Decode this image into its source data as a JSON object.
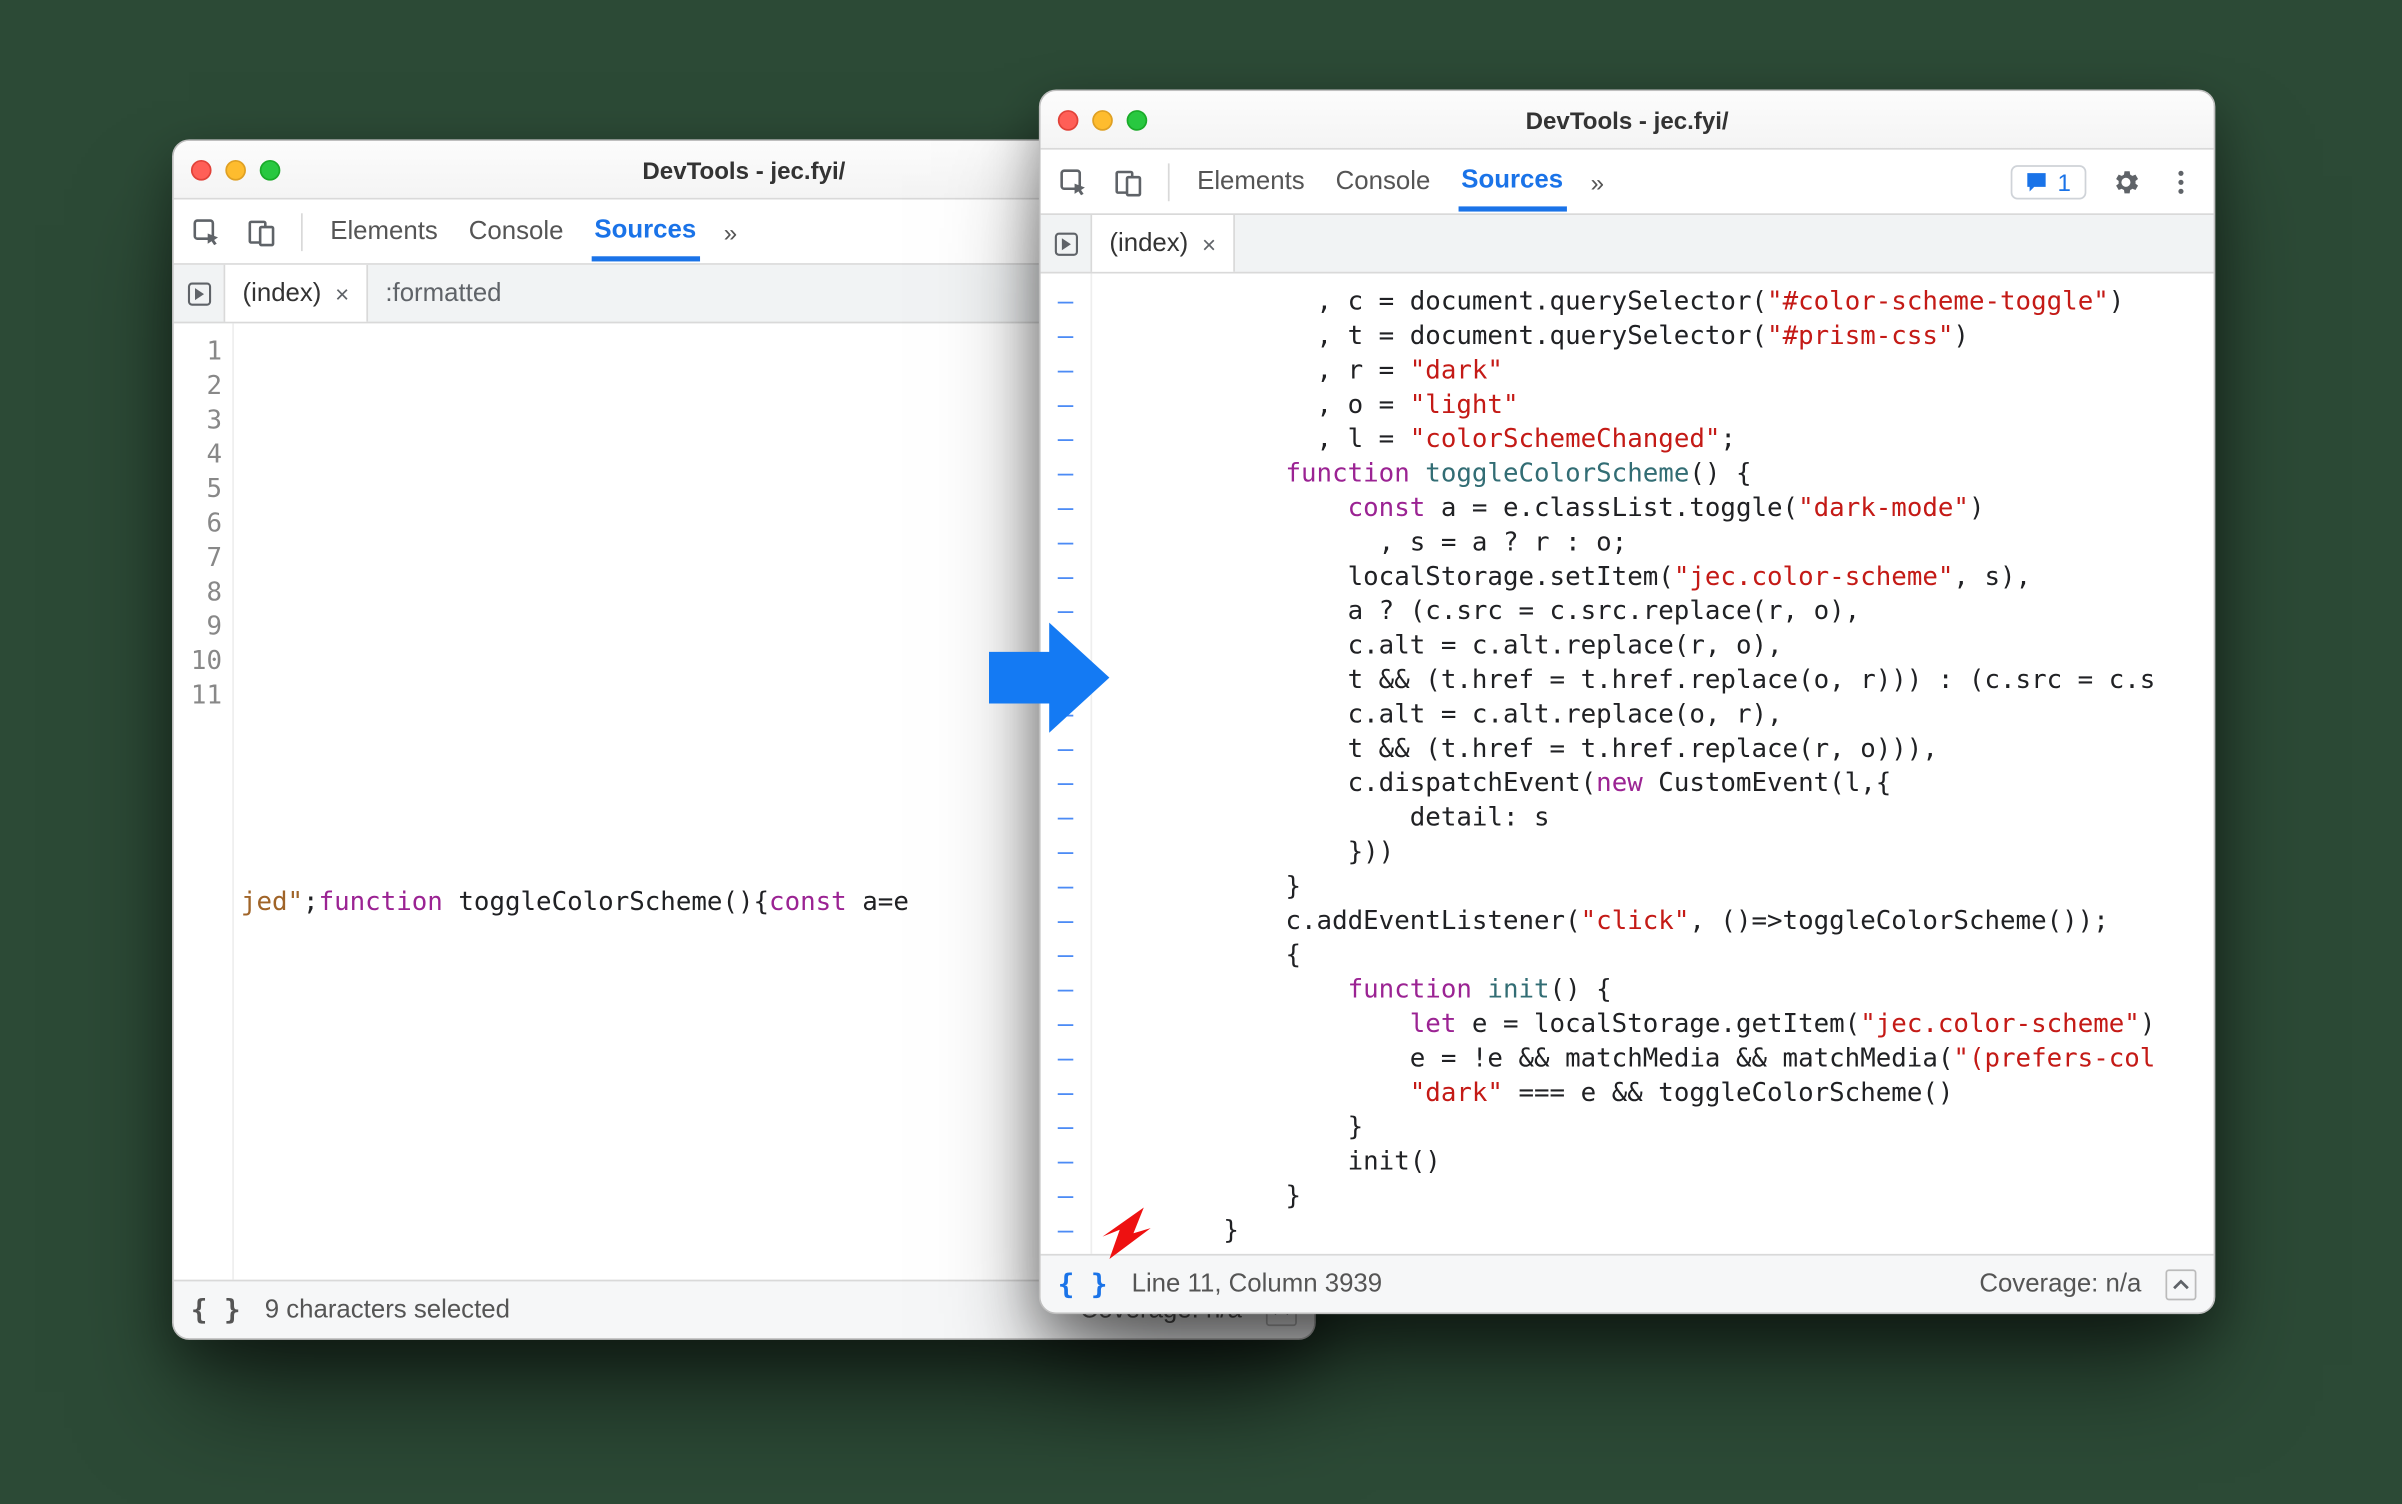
{
  "left": {
    "title": "DevTools - jec.fyi/",
    "tabs": {
      "elements": "Elements",
      "console": "Console",
      "sources": "Sources",
      "more": "»"
    },
    "files": {
      "index": "(index)",
      "formatted": ":formatted"
    },
    "gutter": [
      "1",
      "2",
      "3",
      "4",
      "5",
      "6",
      "7",
      "8",
      "9",
      "10",
      "11"
    ],
    "line11": {
      "trunc": "jed\"",
      "semi": ";",
      "kw1": "function",
      "fn": " toggleColorScheme()",
      "brace": "{",
      "kw2": "const",
      "rest": " a=e"
    },
    "status": {
      "msg": "9 characters selected",
      "cov": "Coverage: n/a"
    }
  },
  "right": {
    "title": "DevTools - jec.fyi/",
    "tabs": {
      "elements": "Elements",
      "console": "Console",
      "sources": "Sources",
      "more": "»",
      "issues": "1"
    },
    "files": {
      "index": "(index)"
    },
    "code": [
      {
        "indent": "              , ",
        "segs": [
          {
            "t": "c = document.querySelector(",
            "c": ""
          },
          {
            "t": "\"#color-scheme-toggle\"",
            "c": "tk-str"
          },
          {
            "t": ")",
            "c": ""
          }
        ]
      },
      {
        "indent": "              , ",
        "segs": [
          {
            "t": "t = document.querySelector(",
            "c": ""
          },
          {
            "t": "\"#prism-css\"",
            "c": "tk-str"
          },
          {
            "t": ")",
            "c": ""
          }
        ]
      },
      {
        "indent": "              , ",
        "segs": [
          {
            "t": "r = ",
            "c": ""
          },
          {
            "t": "\"dark\"",
            "c": "tk-str"
          }
        ]
      },
      {
        "indent": "              , ",
        "segs": [
          {
            "t": "o = ",
            "c": ""
          },
          {
            "t": "\"light\"",
            "c": "tk-str"
          }
        ]
      },
      {
        "indent": "              , ",
        "segs": [
          {
            "t": "l = ",
            "c": ""
          },
          {
            "t": "\"colorSchemeChanged\"",
            "c": "tk-str"
          },
          {
            "t": ";",
            "c": ""
          }
        ]
      },
      {
        "indent": "            ",
        "segs": [
          {
            "t": "function",
            "c": "tk-kw"
          },
          {
            "t": " ",
            "c": ""
          },
          {
            "t": "toggleColorScheme",
            "c": "tk-fn"
          },
          {
            "t": "() {",
            "c": ""
          }
        ]
      },
      {
        "indent": "                ",
        "segs": [
          {
            "t": "const",
            "c": "tk-kw"
          },
          {
            "t": " a = e.classList.toggle(",
            "c": ""
          },
          {
            "t": "\"dark-mode\"",
            "c": "tk-str"
          },
          {
            "t": ")",
            "c": ""
          }
        ]
      },
      {
        "indent": "                  , ",
        "segs": [
          {
            "t": "s = a ? r : o;",
            "c": ""
          }
        ]
      },
      {
        "indent": "                ",
        "segs": [
          {
            "t": "localStorage.setItem(",
            "c": ""
          },
          {
            "t": "\"jec.color-scheme\"",
            "c": "tk-str"
          },
          {
            "t": ", s),",
            "c": ""
          }
        ]
      },
      {
        "indent": "                ",
        "segs": [
          {
            "t": "a ? (c.src = c.src.replace(r, o),",
            "c": ""
          }
        ]
      },
      {
        "indent": "                ",
        "segs": [
          {
            "t": "c.alt = c.alt.replace(r, o),",
            "c": ""
          }
        ]
      },
      {
        "indent": "                ",
        "segs": [
          {
            "t": "t && (t.href = t.href.replace(o, r))) : (c.src = c.s",
            "c": ""
          }
        ]
      },
      {
        "indent": "                ",
        "segs": [
          {
            "t": "c.alt = c.alt.replace(o, r),",
            "c": ""
          }
        ]
      },
      {
        "indent": "                ",
        "segs": [
          {
            "t": "t && (t.href = t.href.replace(r, o))),",
            "c": ""
          }
        ]
      },
      {
        "indent": "                ",
        "segs": [
          {
            "t": "c.dispatchEvent(",
            "c": ""
          },
          {
            "t": "new",
            "c": "tk-kw"
          },
          {
            "t": " CustomEvent(l,{",
            "c": ""
          }
        ]
      },
      {
        "indent": "                    ",
        "segs": [
          {
            "t": "detail: s",
            "c": ""
          }
        ]
      },
      {
        "indent": "                ",
        "segs": [
          {
            "t": "}))",
            "c": ""
          }
        ]
      },
      {
        "indent": "            ",
        "segs": [
          {
            "t": "}",
            "c": ""
          }
        ]
      },
      {
        "indent": "            ",
        "segs": [
          {
            "t": "c.addEventListener(",
            "c": ""
          },
          {
            "t": "\"click\"",
            "c": "tk-str"
          },
          {
            "t": ", ()=>toggleColorScheme());",
            "c": ""
          }
        ]
      },
      {
        "indent": "            ",
        "segs": [
          {
            "t": "{",
            "c": ""
          }
        ]
      },
      {
        "indent": "                ",
        "segs": [
          {
            "t": "function",
            "c": "tk-kw"
          },
          {
            "t": " ",
            "c": ""
          },
          {
            "t": "init",
            "c": "tk-fn"
          },
          {
            "t": "() {",
            "c": ""
          }
        ]
      },
      {
        "indent": "                    ",
        "segs": [
          {
            "t": "let",
            "c": "tk-kw"
          },
          {
            "t": " e = localStorage.getItem(",
            "c": ""
          },
          {
            "t": "\"jec.color-scheme\"",
            "c": "tk-str"
          },
          {
            "t": ")",
            "c": ""
          }
        ]
      },
      {
        "indent": "                    ",
        "segs": [
          {
            "t": "e = !e && matchMedia && matchMedia(",
            "c": ""
          },
          {
            "t": "\"(prefers-col",
            "c": "tk-str"
          }
        ]
      },
      {
        "indent": "                    ",
        "segs": [
          {
            "t": "\"dark\"",
            "c": "tk-str"
          },
          {
            "t": " === e && toggleColorScheme()",
            "c": ""
          }
        ]
      },
      {
        "indent": "                ",
        "segs": [
          {
            "t": "}",
            "c": ""
          }
        ]
      },
      {
        "indent": "                ",
        "segs": [
          {
            "t": "init()",
            "c": ""
          }
        ]
      },
      {
        "indent": "            ",
        "segs": [
          {
            "t": "}",
            "c": ""
          }
        ]
      },
      {
        "indent": "        ",
        "segs": [
          {
            "t": "}",
            "c": ""
          }
        ]
      }
    ],
    "status": {
      "msg": "Line 11, Column 3939",
      "cov": "Coverage: n/a"
    }
  }
}
